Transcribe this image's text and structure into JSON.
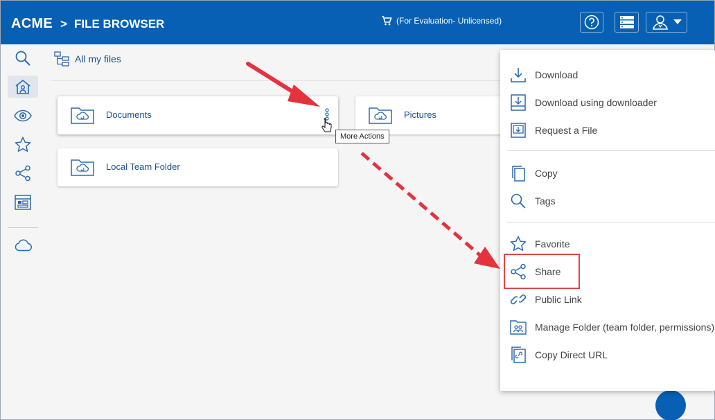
{
  "header": {
    "brand": "ACME",
    "separator": ">",
    "title": "FILE BROWSER",
    "evaluation": "(For Evaluation- Unlicensed)"
  },
  "toolbar": {
    "all_files_label": "All my files"
  },
  "folders": [
    {
      "name": "Documents"
    },
    {
      "name": "Pictures"
    },
    {
      "name": "Local Team Folder"
    }
  ],
  "tooltip": "More Actions",
  "menu": {
    "items": [
      {
        "label": "Download",
        "icon": "download-icon"
      },
      {
        "label": "Download using downloader",
        "icon": "download-tray-icon"
      },
      {
        "label": "Request a File",
        "icon": "request-file-icon"
      },
      {
        "label": "Copy",
        "icon": "copy-icon"
      },
      {
        "label": "Tags",
        "icon": "search-icon"
      },
      {
        "label": "Favorite",
        "icon": "star-icon"
      },
      {
        "label": "Share",
        "icon": "share-icon"
      },
      {
        "label": "Public Link",
        "icon": "link-icon"
      },
      {
        "label": "Manage Folder (team folder, permissions)",
        "icon": "manage-folder-icon"
      },
      {
        "label": "Copy Direct URL",
        "icon": "direct-url-icon"
      }
    ]
  },
  "colors": {
    "brand_blue": "#0760b3",
    "icon_blue": "#2a6ab0",
    "highlight_red": "#e04545"
  }
}
